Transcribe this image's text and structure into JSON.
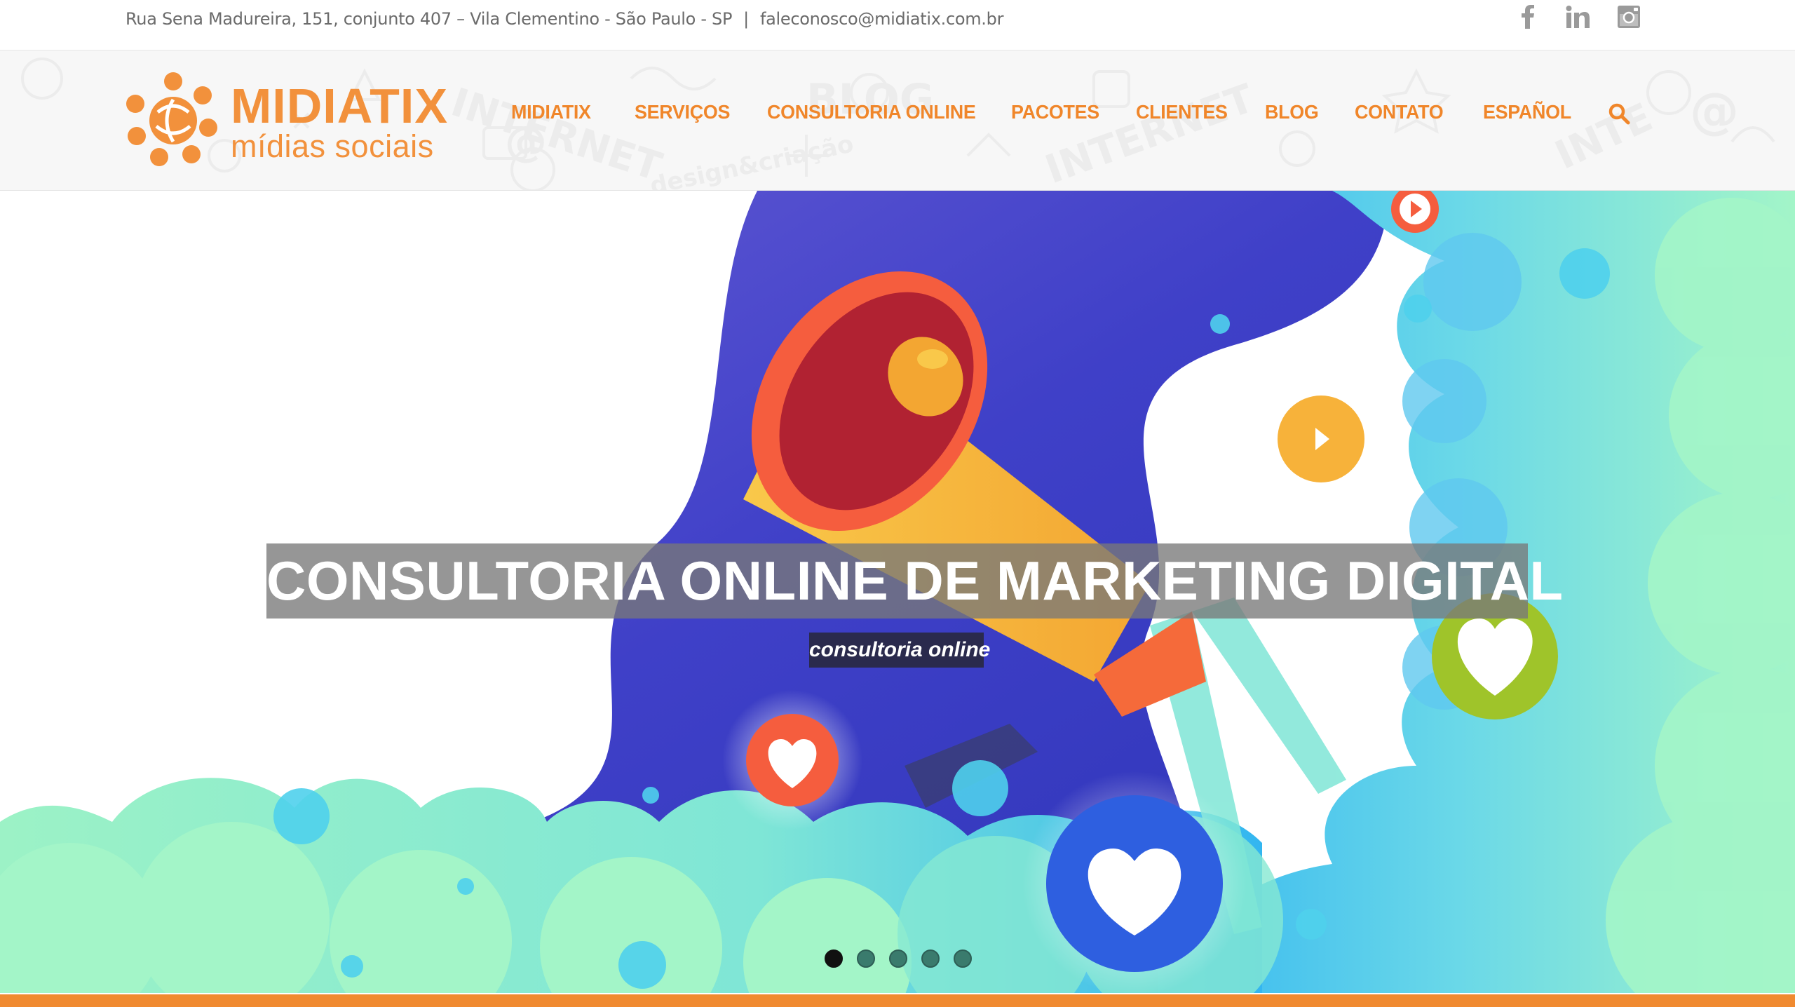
{
  "topbar": {
    "address": "Rua Sena Madureira, 151, conjunto 407 – Vila Clementino - São Paulo - SP",
    "separator": "|",
    "email": "faleconosco@midiatix.com.br",
    "social": [
      "facebook-icon",
      "linkedin-icon",
      "instagram-icon"
    ]
  },
  "logo": {
    "brand": "MIDIATIX",
    "tagline": "mídias sociais"
  },
  "nav": {
    "items": [
      "MIDIATIX",
      "SERVIÇOS",
      "CONSULTORIA ONLINE",
      "PACOTES",
      "CLIENTES",
      "BLOG",
      "CONTATO",
      "ESPAÑOL"
    ],
    "search_icon": "search-icon"
  },
  "hero": {
    "title": "CONSULTORIA ONLINE DE MARKETING DIGITAL",
    "subtitle": "consultoria online",
    "slides": 5,
    "active_slide": 1
  },
  "colors": {
    "brand_orange": "#f2913c",
    "nav_orange": "#f0862a",
    "hero_blue": "#3d3fc4",
    "hero_mint": "#a3f5c8",
    "footer_bar": "#f08a30"
  }
}
